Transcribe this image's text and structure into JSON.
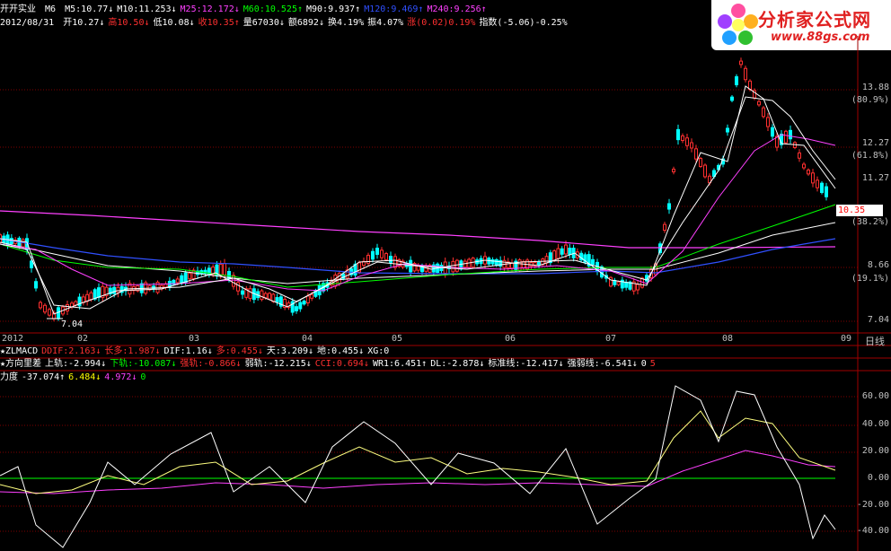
{
  "header": {
    "stock_name": "开开实业",
    "ma_tag": "M6",
    "mas": [
      {
        "text": "M5:10.77↓",
        "color": "#ffffff"
      },
      {
        "text": "M10:11.253↓",
        "color": "#ffffff"
      },
      {
        "text": "M25:12.172↓",
        "color": "#ff40ff"
      },
      {
        "text": "M60:10.525↑",
        "color": "#00ff00"
      },
      {
        "text": "M90:9.937↑",
        "color": "#ffffff"
      },
      {
        "text": "M120:9.469↑",
        "color": "#3050ff"
      },
      {
        "text": "M240:9.256↑",
        "color": "#ff40ff"
      }
    ],
    "date": "2012/08/31",
    "quote": [
      {
        "text": "开10.27↓",
        "color": "#ffffff"
      },
      {
        "text": "高10.50↓",
        "color": "#ff3030"
      },
      {
        "text": "低10.08↓",
        "color": "#ffffff"
      },
      {
        "text": "收10.35↑",
        "color": "#ff3030"
      },
      {
        "text": "量67030↓",
        "color": "#ffffff"
      },
      {
        "text": "额6892↓",
        "color": "#ffffff"
      },
      {
        "text": "换4.19%",
        "color": "#ffffff"
      },
      {
        "text": "振4.07%",
        "color": "#ffffff"
      },
      {
        "text": "涨(0.02)0.19%",
        "color": "#ff3030"
      },
      {
        "text": "指数(-5.06)-0.25%",
        "color": "#ffffff"
      }
    ]
  },
  "logo": {
    "title": "分析家公式网",
    "url": "www.88gs.com"
  },
  "price_axis": [
    {
      "label": "13.88",
      "pct": "(80.9%)"
    },
    {
      "label": "12.27",
      "pct": "(61.8%)"
    },
    {
      "label": "11.27",
      "pct": ""
    },
    {
      "label": "10.35",
      "pct": "(38.2%)"
    },
    {
      "label": "8.66",
      "pct": "(19.1%)"
    },
    {
      "label": "7.04",
      "pct": ""
    }
  ],
  "current_price": "10.35",
  "low_marker": "7.04",
  "date_axis": [
    "2012",
    "02",
    "03",
    "04",
    "05",
    "06",
    "07",
    "08",
    "09"
  ],
  "period_label": "日线",
  "indicator1": [
    {
      "text": "★ZLMACD",
      "color": "#ffffff"
    },
    {
      "text": "DDIF:2.163↓",
      "color": "#ff3030"
    },
    {
      "text": "长多:1.987↓",
      "color": "#ff3030"
    },
    {
      "text": "DIF:1.16↓",
      "color": "#ffffff"
    },
    {
      "text": "多:0.455↓",
      "color": "#ff3030"
    },
    {
      "text": "天:3.209↓",
      "color": "#ffffff"
    },
    {
      "text": "地:0.455↓",
      "color": "#ffffff"
    },
    {
      "text": "XG:0",
      "color": "#ffffff"
    }
  ],
  "indicator2": [
    {
      "text": "★方向里差",
      "color": "#ffffff"
    },
    {
      "text": "上轨:-2.994↓",
      "color": "#ffffff"
    },
    {
      "text": "下轨:-10.087↓",
      "color": "#00ff00"
    },
    {
      "text": "强轨:-0.866↓",
      "color": "#ff3030"
    },
    {
      "text": "弱轨:-12.215↓",
      "color": "#ffffff"
    },
    {
      "text": "CCI:0.694↓",
      "color": "#ff3030"
    },
    {
      "text": "WR1:6.451↑",
      "color": "#ffffff"
    },
    {
      "text": "DL:-2.878↓",
      "color": "#ffffff"
    },
    {
      "text": "标准线:-12.417↓",
      "color": "#ffffff"
    },
    {
      "text": "强弱线:-6.541↓",
      "color": "#ffffff"
    },
    {
      "text": "0",
      "color": "#ffffff"
    },
    {
      "text": "5",
      "color": "#ff3030"
    }
  ],
  "indicator3": [
    {
      "text": "力度",
      "color": "#ffffff"
    },
    {
      "text": "-37.074↑",
      "color": "#ffffff"
    },
    {
      "text": "6.484↓",
      "color": "#ffff00"
    },
    {
      "text": "4.972↓",
      "color": "#ff40ff"
    },
    {
      "text": "0",
      "color": "#00ff00"
    }
  ],
  "lower_axis": [
    "60.00",
    "40.00",
    "20.00",
    "0.00",
    "-20.00",
    "-40.00"
  ]
}
